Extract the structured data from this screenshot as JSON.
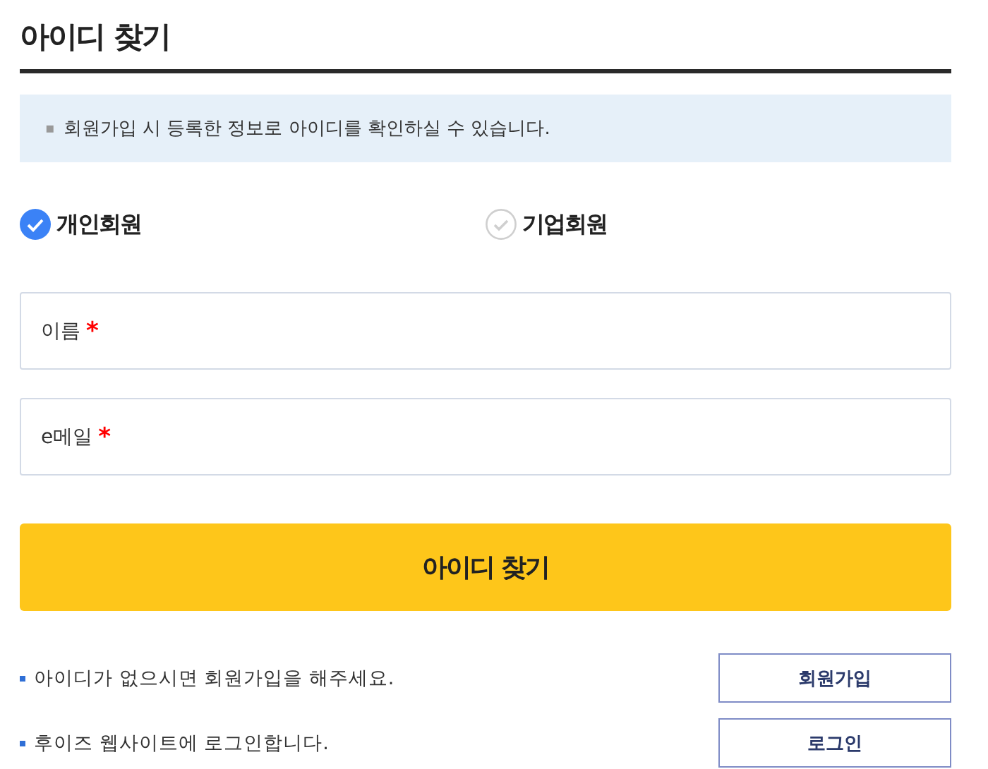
{
  "title": "아이디 찾기",
  "notice": {
    "bullet": "▪",
    "text": "회원가입 시 등록한 정보로 아이디를 확인하실 수 있습니다."
  },
  "member_types": [
    {
      "label": "개인회원",
      "selected": true
    },
    {
      "label": "기업회원",
      "selected": false
    }
  ],
  "fields": [
    {
      "label": "이름",
      "required_mark": "*"
    },
    {
      "label": "e메일",
      "required_mark": "*"
    }
  ],
  "submit_button": "아이디 찾기",
  "links": [
    {
      "text": "아이디가 없으시면 회원가입을 해주세요.",
      "button": "회원가입"
    },
    {
      "text": "후이즈 웹사이트에 로그인합니다.",
      "button": "로그인"
    }
  ]
}
